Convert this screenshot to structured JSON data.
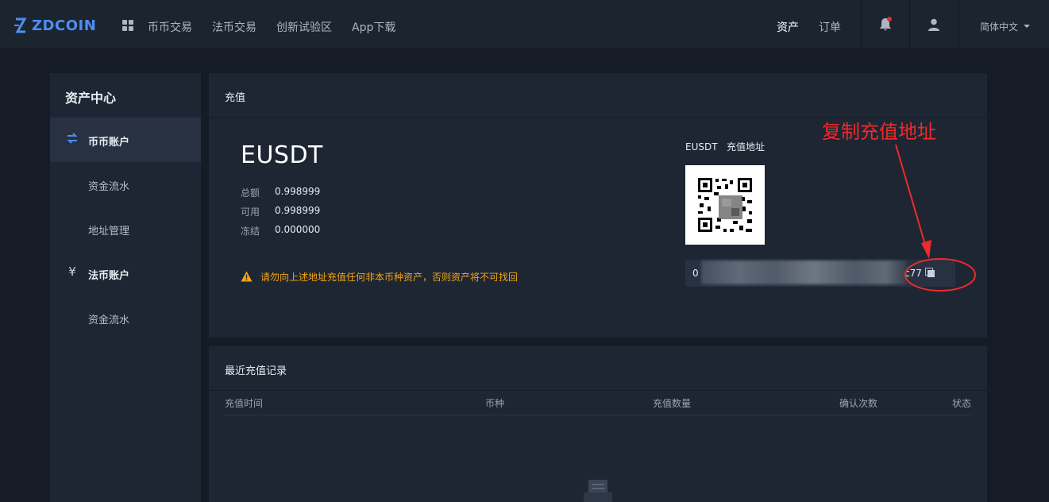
{
  "brand": {
    "name": "ZDCOIN",
    "accent": "#4d8ef2"
  },
  "nav": {
    "items": [
      "币币交易",
      "法币交易",
      "创新试验区",
      "App下载"
    ],
    "assets": "资产",
    "orders": "订单",
    "language": "简体中文"
  },
  "sidebar": {
    "title": "资产中心",
    "items": [
      {
        "label": "币币账户",
        "icon": "exchange-icon"
      },
      {
        "label": "资金流水"
      },
      {
        "label": "地址管理"
      },
      {
        "label": "法币账户",
        "icon": "yen-icon"
      },
      {
        "label": "资金流水"
      }
    ]
  },
  "deposit": {
    "card_title": "充值",
    "coin": "EUSDT",
    "balances": [
      {
        "label": "总额",
        "value": "0.998999"
      },
      {
        "label": "可用",
        "value": "0.998999"
      },
      {
        "label": "冻结",
        "value": "0.000000"
      }
    ],
    "warning": "请勿向上述地址充值任何非本币种资产，否则资产将不可找回",
    "address_title": "EUSDT   充值地址",
    "address_prefix": "0",
    "address_suffix": "c77"
  },
  "records": {
    "card_title": "最近充值记录",
    "columns": [
      "充值时间",
      "币种",
      "充值数量",
      "确认次数",
      "状态"
    ]
  },
  "annotation": {
    "text": "复制充值地址",
    "color": "#ee2b2b"
  }
}
